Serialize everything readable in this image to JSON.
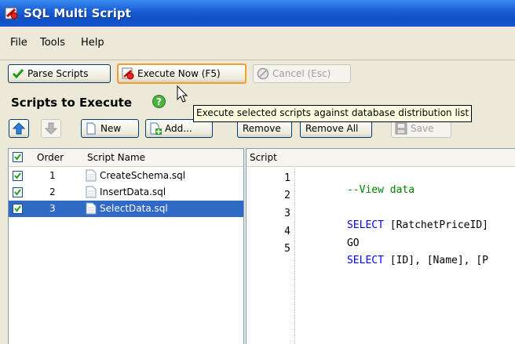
{
  "window": {
    "title": "SQL Multi Script"
  },
  "menu": [
    "File",
    "Tools",
    "Help"
  ],
  "toolbar": {
    "parse": "Parse Scripts",
    "execute": "Execute Now (F5)",
    "cancel": "Cancel (Esc)"
  },
  "section_title": "Scripts to Execute",
  "tooltip": "Execute selected scripts against database distribution list",
  "actions": {
    "new": "New",
    "add": "Add...",
    "remove": "Remove",
    "remove_all": "Remove All",
    "save": "Save"
  },
  "list": {
    "columns": [
      "Order",
      "Script Name"
    ],
    "rows": [
      {
        "checked": true,
        "order": "1",
        "name": "CreateSchema.sql",
        "selected": false
      },
      {
        "checked": true,
        "order": "2",
        "name": "InsertData.sql",
        "selected": false
      },
      {
        "checked": true,
        "order": "3",
        "name": "SelectData.sql",
        "selected": true
      }
    ]
  },
  "script": {
    "header": "Script",
    "line_numbers": [
      "1",
      "2",
      "3",
      "4",
      "5"
    ],
    "lines": [
      {
        "parts": [
          {
            "t": "--View data",
            "c": "cm"
          }
        ]
      },
      {
        "parts": []
      },
      {
        "parts": [
          {
            "t": "SELECT",
            "c": "kw"
          },
          {
            "t": " [RatchetPriceID]",
            "c": ""
          }
        ]
      },
      {
        "parts": [
          {
            "t": "GO",
            "c": ""
          }
        ]
      },
      {
        "parts": [
          {
            "t": "SELECT",
            "c": "kw"
          },
          {
            "t": " [ID], [Name], [P",
            "c": ""
          }
        ]
      }
    ]
  },
  "colors": {
    "title_bar": "#1a5fd6",
    "selection": "#316ac5",
    "keyword": "#0000ff",
    "comment": "#008000"
  }
}
